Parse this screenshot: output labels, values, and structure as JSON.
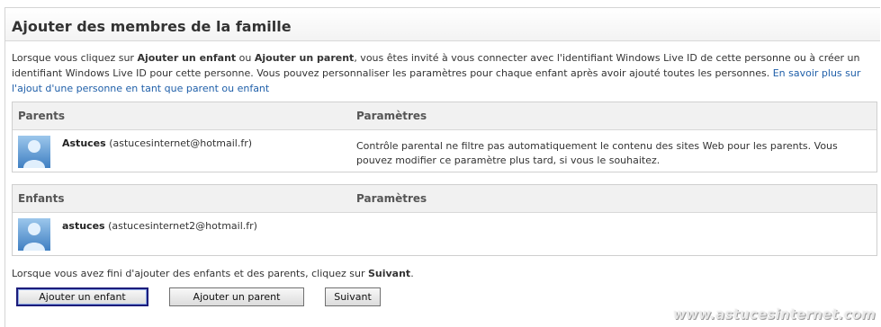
{
  "page": {
    "title": "Ajouter des membres de la famille",
    "intro": {
      "part1": "Lorsque vous cliquez sur ",
      "add_child_bold": "Ajouter un enfant",
      "part2": " ou ",
      "add_parent_bold": "Ajouter un parent",
      "part3": ", vous êtes invité à vous connecter avec l'identifiant Windows Live ID de cette personne ou à créer un identifiant Windows Live ID pour cette personne. Vous pouvez personnaliser les paramètres pour chaque enfant après avoir ajouté toutes les personnes. ",
      "link": "En savoir plus sur l'ajout d'une personne en tant que parent ou enfant"
    }
  },
  "parents": {
    "header_col1": "Parents",
    "header_col2": "Paramètres",
    "rows": [
      {
        "name": "Astuces",
        "email": "(astucesinternet@hotmail.fr)",
        "setting": "Contrôle parental ne filtre pas automatiquement le contenu des sites Web pour les parents. Vous pouvez modifier ce paramètre plus tard, si vous le souhaitez."
      }
    ]
  },
  "children": {
    "header_col1": "Enfants",
    "header_col2": "Paramètres",
    "rows": [
      {
        "name": "astuces",
        "email": "(astucesinternet2@hotmail.fr)",
        "setting": ""
      }
    ]
  },
  "footer": {
    "text_part1": "Lorsque vous avez fini d'ajouter des enfants et des parents, cliquez sur ",
    "text_bold": "Suivant",
    "text_part2": "."
  },
  "buttons": {
    "add_child": "Ajouter un enfant",
    "add_parent": "Ajouter un parent",
    "next": "Suivant"
  },
  "watermark": "www.astucesinternet.com",
  "colors": {
    "link": "#1f5fa9",
    "header_bg": "#f1f1f1",
    "primary_border": "#1c1c7a"
  }
}
